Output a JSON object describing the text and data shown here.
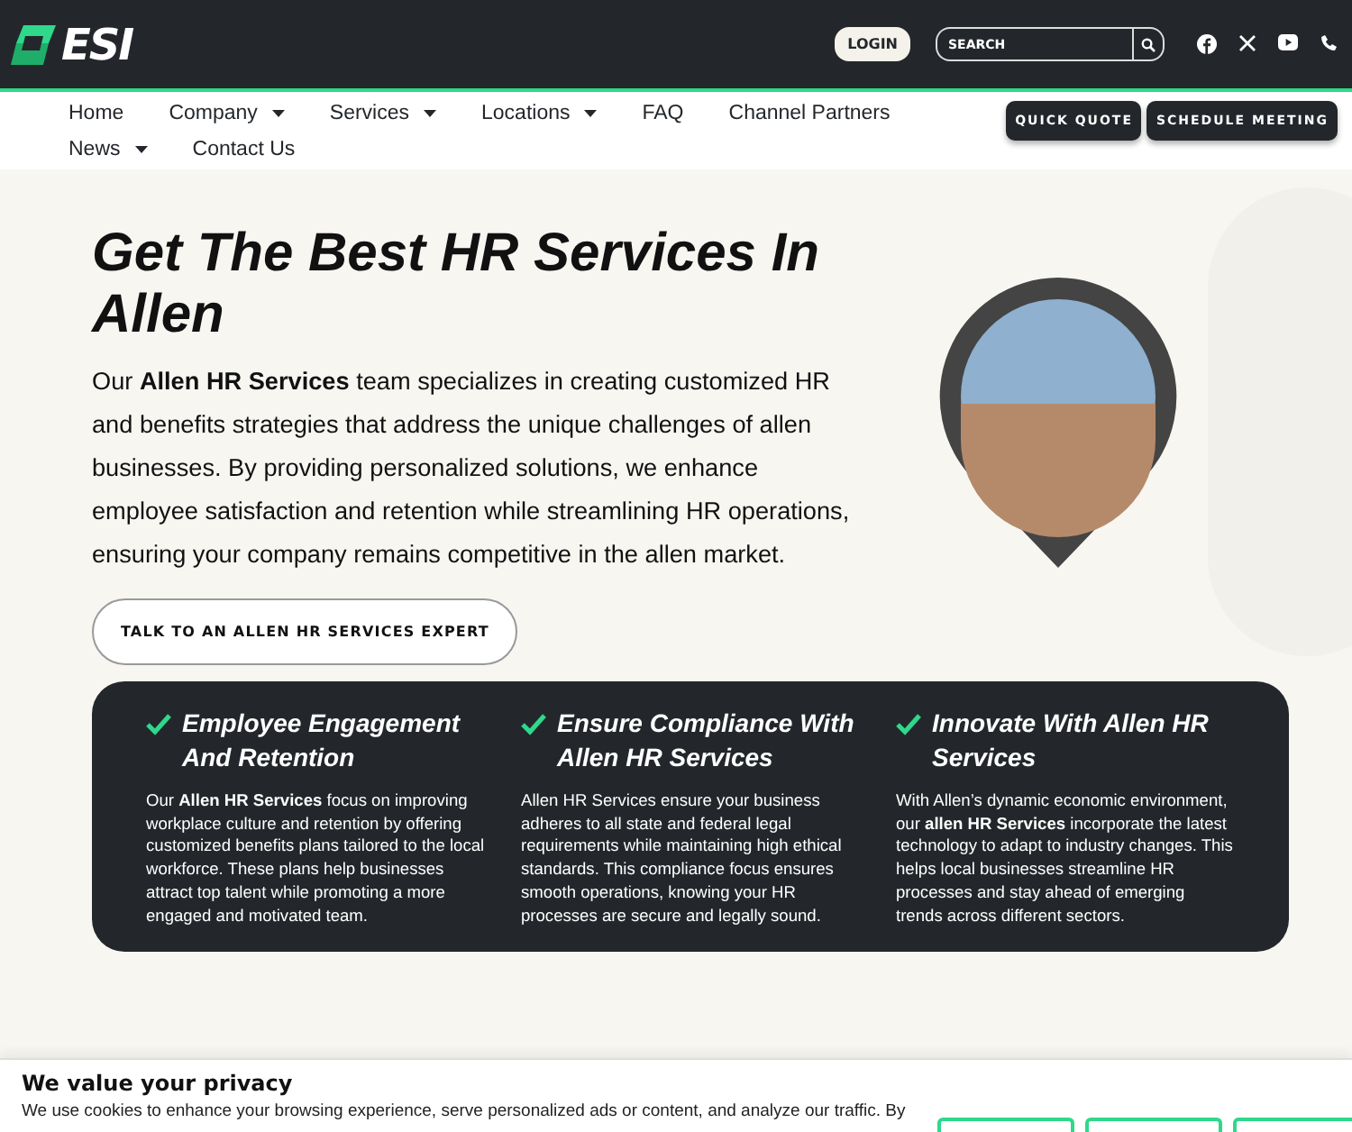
{
  "header": {
    "logo": "ESI",
    "login": "LOGIN",
    "search": {
      "placeholder": "SEARCH"
    }
  },
  "nav": {
    "items": [
      {
        "label": "Home",
        "has_menu": false
      },
      {
        "label": "Company",
        "has_menu": true
      },
      {
        "label": "Services",
        "has_menu": true
      },
      {
        "label": "Locations",
        "has_menu": true
      },
      {
        "label": "FAQ",
        "has_menu": false
      },
      {
        "label": "Channel Partners",
        "has_menu": false
      },
      {
        "label": "News",
        "has_menu": true
      },
      {
        "label": "Contact Us",
        "has_menu": false
      }
    ],
    "cta_buttons": [
      "QUICK QUOTE",
      "SCHEDULE MEETING"
    ]
  },
  "hero": {
    "title": "Get The Best HR Services In Allen",
    "body": "Our **Allen HR Services** team specializes in creating customized HR and benefits strategies that address the unique challenges of allen businesses. By providing personalized solutions, we enhance employee satisfaction and retention while streamlining HR operations, ensuring your company remains competitive in the allen market.",
    "button": "TALK TO AN ALLEN HR SERVICES EXPERT"
  },
  "features": [
    {
      "title": "Employee Engagement And Retention",
      "body": "Our **Allen HR Services** focus on improving workplace culture and retention by offering customized benefits plans tailored to the local workforce. These plans help businesses attract top talent while promoting a more engaged and motivated team."
    },
    {
      "title": "Ensure Compliance With Allen HR Services",
      "body": "Allen HR Services ensure your business adheres to all state and federal legal requirements while maintaining high ethical standards. This compliance focus ensures smooth operations, knowing your HR processes are secure and legally sound."
    },
    {
      "title": "Innovate With Allen HR Services",
      "body": "With Allen’s dynamic economic environment, our **allen HR Services** incorporate the latest technology to adapt to industry changes. This helps local businesses streamline HR processes and stay ahead of emerging trends across different sectors."
    }
  ],
  "cookie": {
    "title": "We value your privacy",
    "text": "We use cookies to enhance your browsing experience, serve personalized ads or content, and analyze our traffic. By"
  }
}
